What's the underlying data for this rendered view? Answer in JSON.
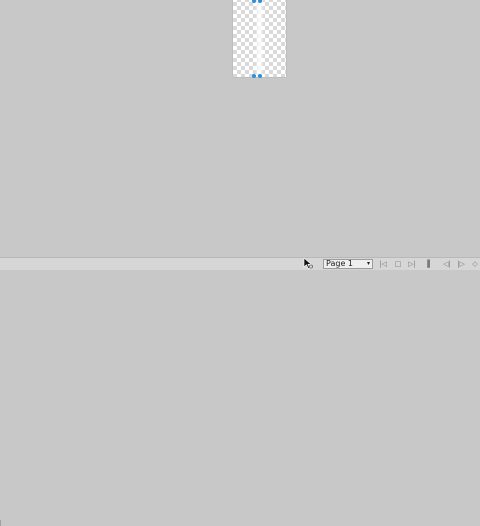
{
  "canvas": {
    "selection_handles": [
      "top-handle",
      "bottom-handle"
    ]
  },
  "statusbar": {
    "page_selector": {
      "value": "Page 1",
      "chevron": "▾"
    },
    "nav_buttons": [
      {
        "icon": "first-page-icon",
        "glyph": "|◁"
      },
      {
        "icon": "prev-page-icon",
        "glyph": "□"
      },
      {
        "icon": "next-page-icon",
        "glyph": "▷|"
      },
      {
        "icon": "last-page-icon",
        "glyph": "▌"
      },
      {
        "icon": "zoom-out-icon",
        "glyph": "◁|"
      },
      {
        "icon": "zoom-fit-icon",
        "glyph": "|▷"
      },
      {
        "icon": "zoom-in-icon",
        "glyph": "◇"
      }
    ]
  }
}
